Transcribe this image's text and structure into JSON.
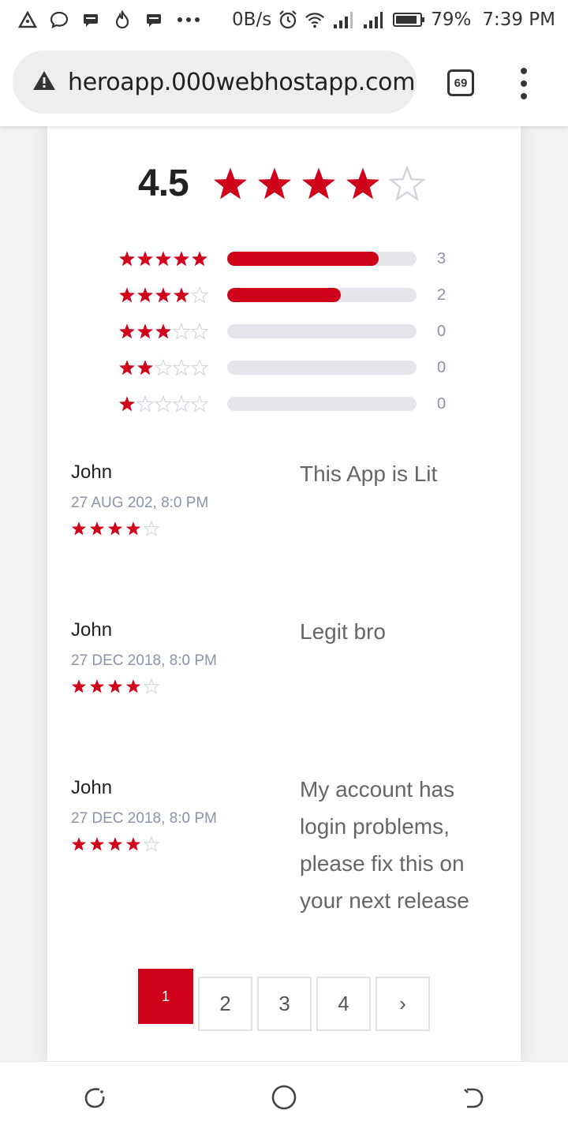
{
  "status_bar": {
    "icons": [
      "delta-icon",
      "chat-bubble-icon",
      "message-icon",
      "flame-icon",
      "message-icon",
      "more-dots-icon"
    ],
    "net_speed": "0B/s",
    "battery": "79%",
    "time": "7:39 PM"
  },
  "browser": {
    "url": "heroapp.000webhostapp.com",
    "tab_count": "69"
  },
  "rating_summary": {
    "score": "4.5",
    "score_value": 4.5,
    "accent_color": "#d0021b",
    "breakdown": [
      {
        "stars": 5,
        "count": "3",
        "fill_fraction": 0.8
      },
      {
        "stars": 4,
        "count": "2",
        "fill_fraction": 0.6
      },
      {
        "stars": 3,
        "count": "0",
        "fill_fraction": 0
      },
      {
        "stars": 2,
        "count": "0",
        "fill_fraction": 0
      },
      {
        "stars": 1,
        "count": "0",
        "fill_fraction": 0
      }
    ]
  },
  "reviews": [
    {
      "name": "John",
      "date": "27 AUG 202, 8:0 PM",
      "stars": 4,
      "text": "This App is Lit"
    },
    {
      "name": "John",
      "date": "27 DEC 2018, 8:0 PM",
      "stars": 4,
      "text": "Legit bro"
    },
    {
      "name": "John",
      "date": "27 DEC 2018, 8:0 PM",
      "stars": 4,
      "text": "My account has login problems, please fix this on your next release"
    }
  ],
  "pagination": {
    "pages": [
      "1",
      "2",
      "3",
      "4"
    ],
    "active": "1",
    "next_label": "›"
  }
}
